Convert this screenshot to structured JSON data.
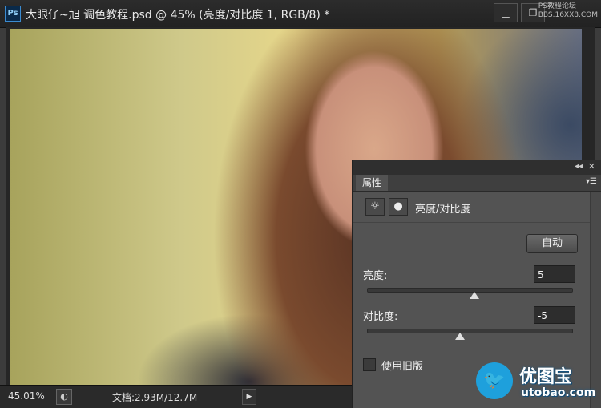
{
  "window": {
    "app_icon": "Ps",
    "title": "大眼仔~旭 调色教程.psd @ 45% (亮度/对比度 1, RGB/8) *",
    "minimize_icon": "minimize-icon",
    "restore_icon": "restore-icon",
    "watermark_line1": "PS教程论坛",
    "watermark_line2": "BBS.16XX8.COM"
  },
  "statusbar": {
    "zoom": "45.01%",
    "doc_info": "文档:2.93M/12.7M"
  },
  "properties_panel": {
    "tab_label": "属性",
    "adjustment_title": "亮度/对比度",
    "auto_button": "自动",
    "brightness": {
      "label": "亮度:",
      "value": "5",
      "level": 0.52
    },
    "contrast": {
      "label": "对比度:",
      "value": "-5",
      "level": 0.45
    },
    "legacy_label": "使用旧版",
    "legacy_checked": false
  },
  "watermark": {
    "brand": "优图宝",
    "domain": "utobao.com"
  },
  "colors": {
    "panel_bg": "#535353",
    "title_bg": "#2c2c2c",
    "brand_blue": "#1ea0dc"
  }
}
